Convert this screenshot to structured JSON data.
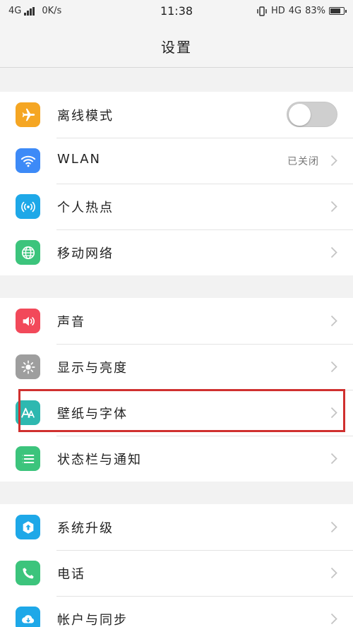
{
  "status_bar": {
    "network_type": "4G",
    "speed": "0K/s",
    "time": "11:38",
    "hd": "HD",
    "network_type_right": "4G",
    "battery": "83%"
  },
  "header": {
    "title": "设置"
  },
  "groups": [
    {
      "items": [
        {
          "label": "离线模式",
          "icon": "airplane-icon",
          "color": "#f5a623",
          "control": "toggle",
          "toggle_on": false
        },
        {
          "label": "WLAN",
          "icon": "wifi-icon",
          "color": "#3d8af7",
          "value": "已关闭"
        },
        {
          "label": "个人热点",
          "icon": "hotspot-icon",
          "color": "#1ea8e8"
        },
        {
          "label": "移动网络",
          "icon": "globe-icon",
          "color": "#3cc47c"
        }
      ]
    },
    {
      "items": [
        {
          "label": "声音",
          "icon": "speaker-icon",
          "color": "#f2495a"
        },
        {
          "label": "显示与亮度",
          "icon": "brightness-icon",
          "color": "#9e9e9e"
        },
        {
          "label": "壁纸与字体",
          "icon": "font-icon",
          "color": "#2eb8b0"
        },
        {
          "label": "状态栏与通知",
          "icon": "list-icon",
          "color": "#3cc47c"
        }
      ]
    },
    {
      "items": [
        {
          "label": "系统升级",
          "icon": "upgrade-icon",
          "color": "#1ea8e8"
        },
        {
          "label": "电话",
          "icon": "phone-icon",
          "color": "#3cc47c"
        },
        {
          "label": "帐户与同步",
          "icon": "cloud-sync-icon",
          "color": "#1ea8e8"
        }
      ]
    }
  ]
}
